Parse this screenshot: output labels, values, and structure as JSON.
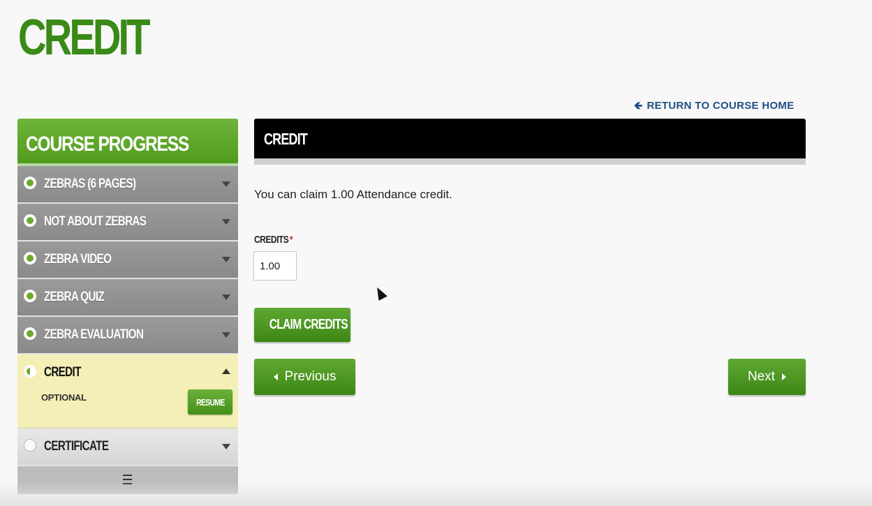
{
  "page": {
    "title": "CREDIT"
  },
  "return_link": {
    "label": "RETURN TO COURSE HOME"
  },
  "sidebar": {
    "title": "COURSE PROGRESS",
    "items": [
      {
        "label": "ZEBRAS (6 PAGES)",
        "status": "complete"
      },
      {
        "label": "NOT ABOUT ZEBRAS",
        "status": "complete"
      },
      {
        "label": "ZEBRA VIDEO",
        "status": "complete"
      },
      {
        "label": "ZEBRA QUIZ",
        "status": "complete"
      },
      {
        "label": "ZEBRA EVALUATION",
        "status": "complete"
      },
      {
        "label": "CREDIT",
        "status": "in-progress",
        "sublabel": "OPTIONAL",
        "action": "RESUME"
      },
      {
        "label": "CERTIFICATE",
        "status": "not-started"
      }
    ]
  },
  "main": {
    "section_title": "CREDIT",
    "intro": "You can claim 1.00 Attendance credit.",
    "credits_label": "CREDITS",
    "required_mark": "*",
    "credits_value": "1.00",
    "claim_button": "CLAIM CREDITS",
    "previous_button": "Previous",
    "next_button": "Next"
  },
  "colors": {
    "title_green": "#3a8a17",
    "button_green": "#4f9a1c",
    "active_item_bg": "#f4efb6",
    "header_black": "#000000",
    "link_blue": "#1f4f86"
  }
}
